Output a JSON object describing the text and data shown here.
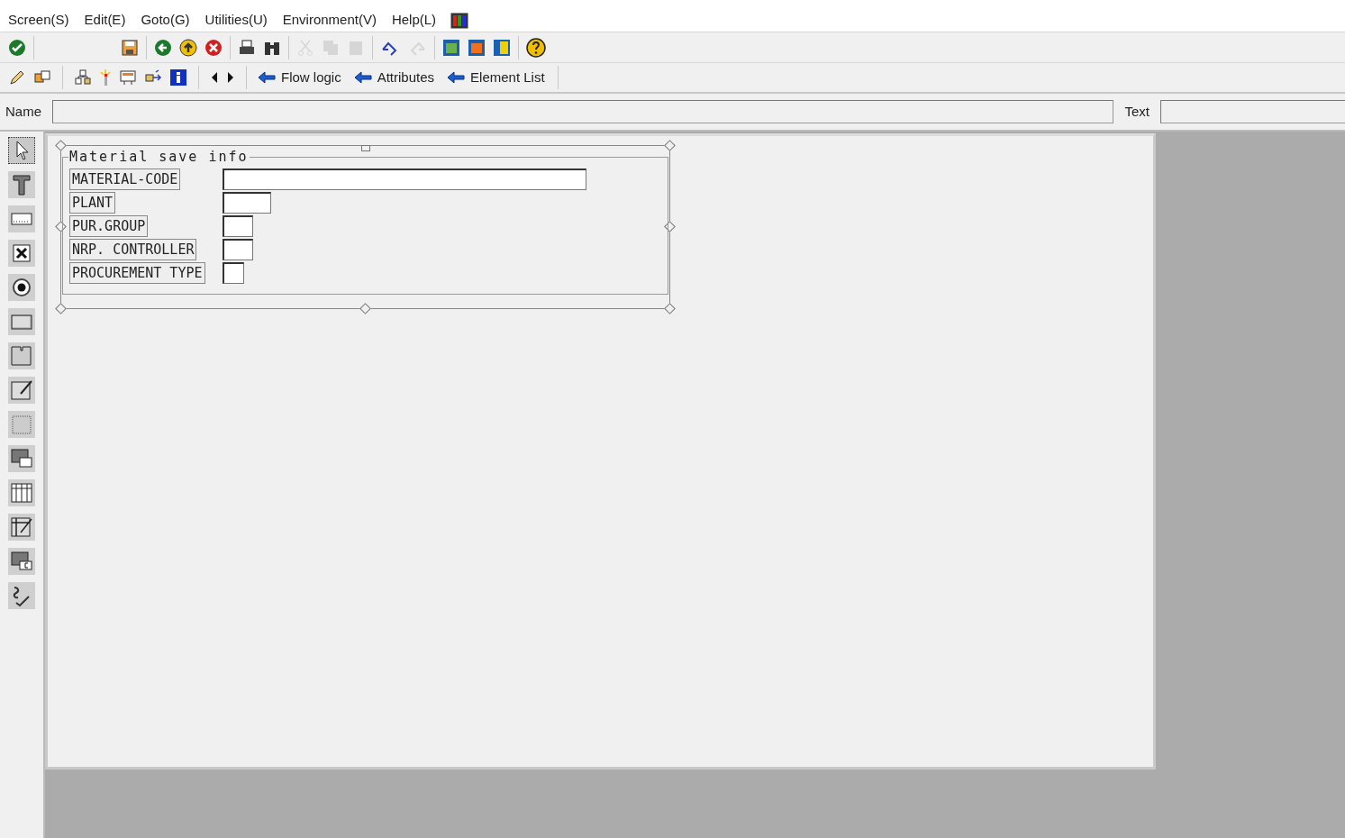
{
  "menu": [
    {
      "label": "Screen(S)"
    },
    {
      "label": "Edit(E)"
    },
    {
      "label": "Goto(G)"
    },
    {
      "label": "Utilities(U)"
    },
    {
      "label": "Environment(V)"
    },
    {
      "label": "Help(L)"
    }
  ],
  "toolbar": [
    {
      "kind": "check",
      "disabled": false
    },
    {
      "kind": "sep"
    },
    {
      "kind": "save",
      "disabled": false
    },
    {
      "kind": "sep"
    },
    {
      "kind": "back",
      "disabled": false
    },
    {
      "kind": "exit",
      "disabled": false
    },
    {
      "kind": "cancel",
      "disabled": false
    },
    {
      "kind": "sep"
    },
    {
      "kind": "print",
      "disabled": false
    },
    {
      "kind": "find",
      "disabled": false
    },
    {
      "kind": "sep"
    },
    {
      "kind": "cut",
      "disabled": true
    },
    {
      "kind": "copy",
      "disabled": true
    },
    {
      "kind": "paste",
      "disabled": true
    },
    {
      "kind": "sep"
    },
    {
      "kind": "undo",
      "disabled": false
    },
    {
      "kind": "redo",
      "disabled": true
    },
    {
      "kind": "sep"
    },
    {
      "kind": "layout-a",
      "disabled": false
    },
    {
      "kind": "layout-b",
      "disabled": false
    },
    {
      "kind": "layout-c",
      "disabled": false
    },
    {
      "kind": "sep"
    },
    {
      "kind": "help",
      "disabled": false
    }
  ],
  "toolbar2": {
    "tools": [
      {
        "kind": "pencil"
      },
      {
        "kind": "stack"
      },
      {
        "kind": "sep"
      },
      {
        "kind": "tree"
      },
      {
        "kind": "spark"
      },
      {
        "kind": "dict"
      },
      {
        "kind": "move"
      },
      {
        "kind": "info"
      },
      {
        "kind": "sep"
      },
      {
        "kind": "prev"
      },
      {
        "kind": "next"
      },
      {
        "kind": "sep"
      }
    ],
    "links": [
      {
        "label": "Flow logic"
      },
      {
        "label": "Attributes"
      },
      {
        "label": "Element List"
      }
    ]
  },
  "name_bar": {
    "name_label": "Name",
    "text_label": "Text"
  },
  "palette": [
    {
      "kind": "pointer",
      "selected": true
    },
    {
      "kind": "text",
      "selected": false
    },
    {
      "kind": "input",
      "selected": false
    },
    {
      "kind": "checkbox",
      "selected": false
    },
    {
      "kind": "radio",
      "selected": false
    },
    {
      "kind": "pushbutton",
      "selected": false
    },
    {
      "kind": "tabstrip",
      "selected": false
    },
    {
      "kind": "tabwizard",
      "selected": false
    },
    {
      "kind": "box",
      "selected": false
    },
    {
      "kind": "subscreen",
      "selected": false
    },
    {
      "kind": "table",
      "selected": false
    },
    {
      "kind": "tablewizard",
      "selected": false
    },
    {
      "kind": "custom",
      "selected": false
    },
    {
      "kind": "status",
      "selected": false
    }
  ],
  "screen": {
    "group_title": "Material save info",
    "fields": [
      {
        "label": "MATERIAL-CODE"
      },
      {
        "label": "PLANT"
      },
      {
        "label": "PUR.GROUP"
      },
      {
        "label": "NRP. CONTROLLER"
      },
      {
        "label": "PROCUREMENT TYPE"
      }
    ]
  }
}
